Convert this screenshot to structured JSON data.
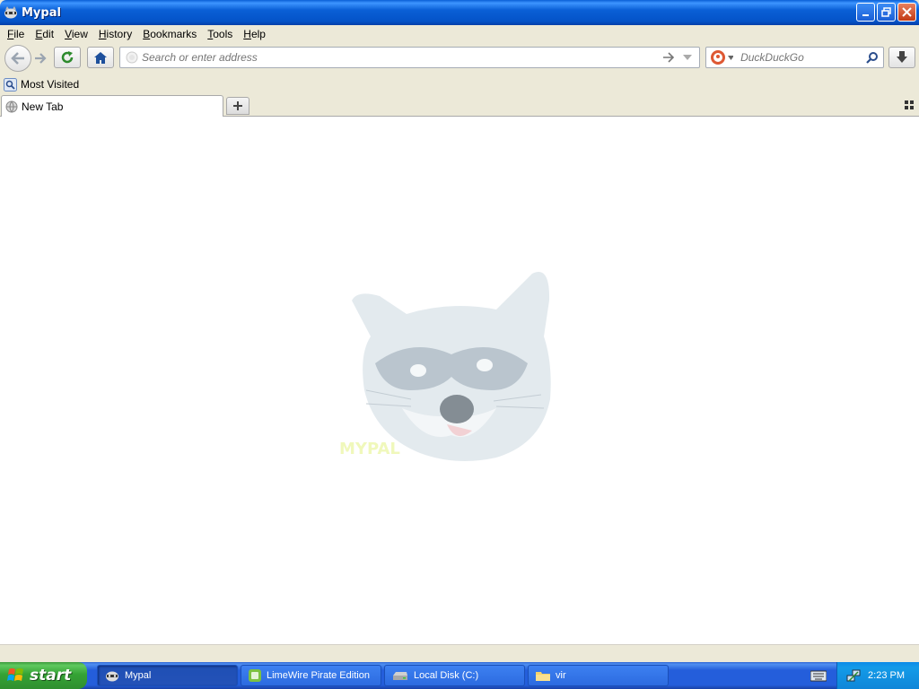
{
  "window": {
    "title": "Mypal"
  },
  "menu": [
    {
      "label": "File",
      "acc": "F",
      "rest": "ile"
    },
    {
      "label": "Edit",
      "acc": "E",
      "rest": "dit"
    },
    {
      "label": "View",
      "acc": "V",
      "rest": "iew"
    },
    {
      "label": "History",
      "acc": "H",
      "rest": "istory"
    },
    {
      "label": "Bookmarks",
      "acc": "B",
      "rest": "ookmarks"
    },
    {
      "label": "Tools",
      "acc": "T",
      "rest": "ools"
    },
    {
      "label": "Help",
      "acc": "H",
      "rest": "elp"
    }
  ],
  "urlbar": {
    "placeholder": "Search or enter address",
    "value": ""
  },
  "searchbar": {
    "placeholder": "DuckDuckGo",
    "engine_icon": "duckduckgo-icon"
  },
  "bookmarks": [
    {
      "label": "Most Visited",
      "icon": "most-visited-icon"
    }
  ],
  "tabs": [
    {
      "label": "New Tab",
      "active": true
    }
  ],
  "content": {
    "logo_text": "MYPAL"
  },
  "taskbar": {
    "start_label": "start",
    "tasks": [
      {
        "label": "Mypal",
        "icon": "mypal-icon",
        "active": true
      },
      {
        "label": "LimeWire Pirate Edition",
        "icon": "limewire-icon",
        "active": false
      },
      {
        "label": "Local Disk (C:)",
        "icon": "drive-icon",
        "active": false
      },
      {
        "label": "vir",
        "icon": "folder-icon",
        "active": false
      }
    ],
    "clock": "2:23 PM"
  },
  "colors": {
    "titlebar": "#0a5fd6",
    "taskbar": "#245edb",
    "start": "#35a335",
    "tray": "#0f86d8"
  }
}
